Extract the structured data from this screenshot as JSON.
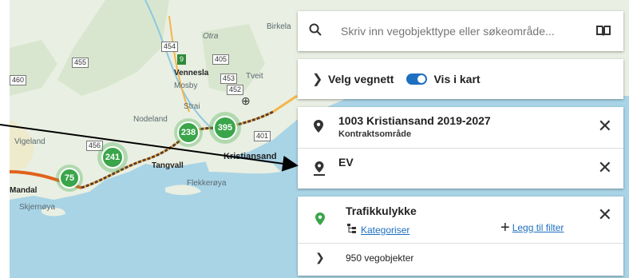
{
  "search": {
    "placeholder": "Skriv inn vegobjekttype eller søkeområde..."
  },
  "vegnett": {
    "label": "Velg vegnett",
    "toggle_label": "Vis i kart",
    "toggle_on": true
  },
  "filters": [
    {
      "title": "1003 Kristiansand 2019-2027",
      "subtitle": "Kontraktsområde"
    },
    {
      "title": "EV",
      "subtitle": ""
    }
  ],
  "trafikk": {
    "title": "Trafikkulykke",
    "categorize_label": "Kategoriser",
    "add_filter_label": "Legg til filter",
    "count_label": "950 vegobjekter"
  },
  "map": {
    "labels": [
      "Otra",
      "Birkela",
      "Vennesla",
      "Mosby",
      "Tveit",
      "Strai",
      "Nodeland",
      "Vigeland",
      "Tangvall",
      "Kristiansand",
      "Flekkerøya",
      "Mandal",
      "Skjernøya"
    ],
    "road_numbers": [
      "454",
      "455",
      "460",
      "405",
      "453",
      "452",
      "456",
      "401",
      "9"
    ],
    "clusters": [
      {
        "count": "238"
      },
      {
        "count": "395"
      },
      {
        "count": "241"
      },
      {
        "count": "75"
      }
    ]
  },
  "colors": {
    "accent": "#1e6fbf",
    "cluster": "#3aa54a",
    "water": "#a9d4e6",
    "land": "#e8efe3"
  }
}
